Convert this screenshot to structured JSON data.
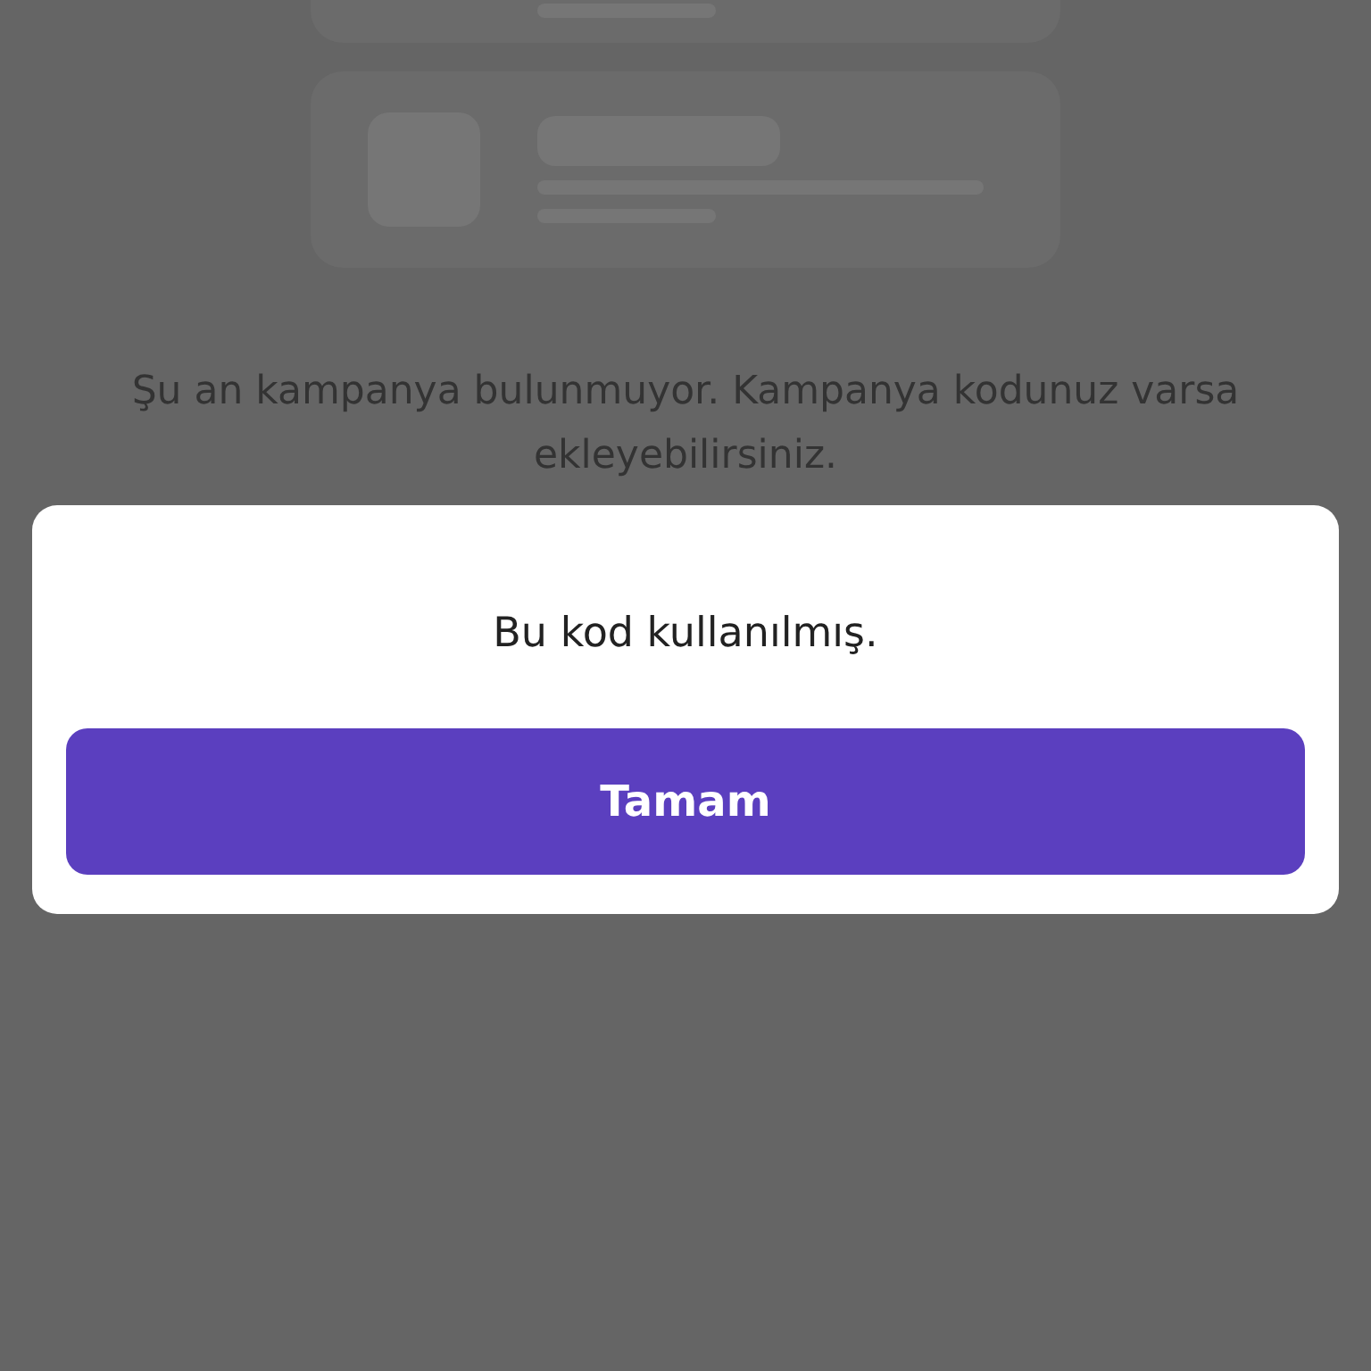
{
  "background": {
    "empty_message": "Şu an kampanya bulunmuyor. Kampanya kodunuz varsa ekleyebilirsiniz."
  },
  "dialog": {
    "message": "Bu kod kullanılmış.",
    "buttons": [
      {
        "label": "Tamam",
        "kind": "primary"
      }
    ]
  }
}
